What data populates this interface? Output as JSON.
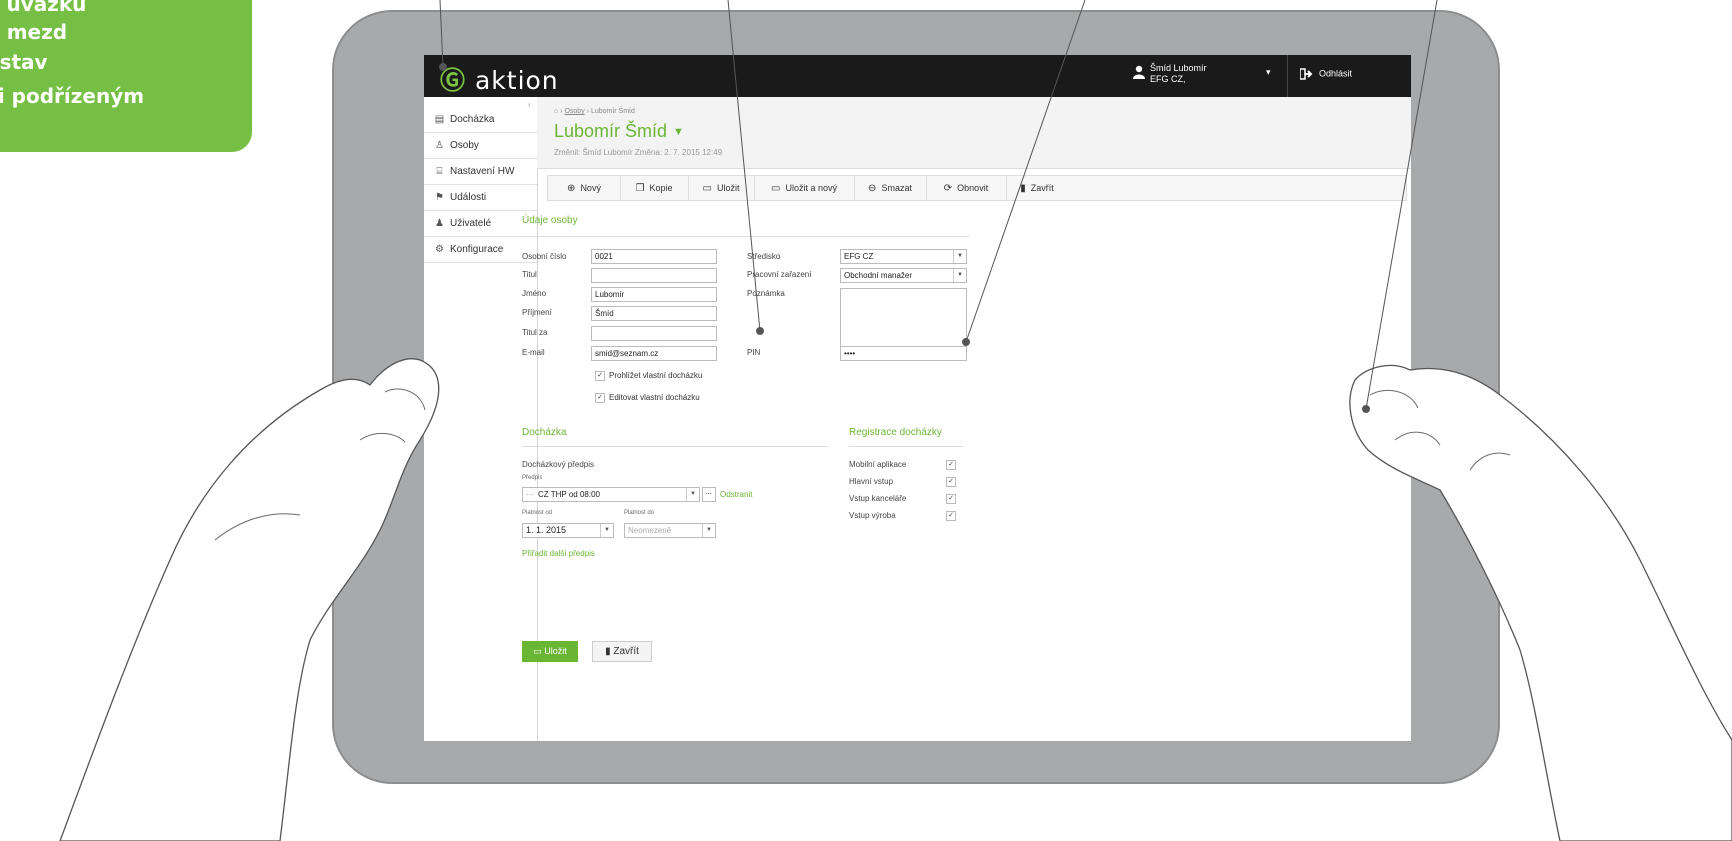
{
  "callout": {
    "lines": [
      "a úvazku",
      "o mezd",
      "estav",
      "či podřízeným"
    ],
    "color": "#74bf44"
  },
  "app": {
    "logo": "aktion",
    "accent": "#6bb535"
  },
  "topbar": {
    "user_name": "Šmíd Lubomír",
    "user_org": "EFG CZ,",
    "logout_label": "Odhlásit"
  },
  "sidebar": {
    "items": [
      {
        "label": "Docházka",
        "icon": "calendar-icon"
      },
      {
        "label": "Osoby",
        "icon": "person-icon"
      },
      {
        "label": "Nastavení HW",
        "icon": "hardware-icon"
      },
      {
        "label": "Události",
        "icon": "events-icon"
      },
      {
        "label": "Uživatelé",
        "icon": "users-icon"
      },
      {
        "label": "Konfigurace",
        "icon": "gear-icon"
      }
    ]
  },
  "header": {
    "breadcrumb_link": "Osoby",
    "breadcrumb_current": "Lubomír Šmíd",
    "title": "Lubomír Šmíd",
    "changed_info": "Změnil: Šmíd Lubomír Změna: 2. 7. 2015 12:49"
  },
  "toolbar": {
    "new": "Nový",
    "copy": "Kopie",
    "save": "Uložit",
    "save_new": "Uložit a nový",
    "delete": "Smazat",
    "refresh": "Obnovit",
    "close": "Zavřít"
  },
  "person": {
    "section_title": "Údaje osoby",
    "personal_number_label": "Osobní číslo",
    "personal_number": "0021",
    "title_label": "Titul",
    "title_value": "",
    "first_name_label": "Jméno",
    "first_name": "Lubomír",
    "last_name_label": "Příjmení",
    "last_name": "Šmíd",
    "title_after_label": "Titul za",
    "title_after": "",
    "email_label": "E-mail",
    "email": "smid@seznam.cz",
    "view_own_label": "Prohlížet vlastní docházku",
    "edit_own_label": "Editovat vlastní docházku",
    "center_label": "Středisko",
    "center": "EFG CZ",
    "position_label": "Pracovní zařazení",
    "position": "Obchodní manažer",
    "note_label": "Poznámka",
    "note": "",
    "pin_label": "PIN",
    "pin": "••••"
  },
  "attendance": {
    "section_title": "Docházka",
    "rule_title": "Docházkový předpis",
    "rule_small_label": "Předpis",
    "rule_value": "CZ THP od 08:00",
    "remove_link": "Odstranit",
    "valid_from_label": "Platnost od",
    "valid_from": "1. 1. 2015",
    "valid_to_label": "Platnost do",
    "valid_to": "Neomezeně",
    "add_rule_link": "Přiřadit další předpis"
  },
  "registration": {
    "section_title": "Registrace docházky",
    "items": [
      {
        "label": "Mobilní aplikace",
        "checked": "✓"
      },
      {
        "label": "Hlavní vstup",
        "checked": "✓"
      },
      {
        "label": "Vstup kanceláře",
        "checked": "✓"
      },
      {
        "label": "Vstup výroba",
        "checked": "✓"
      }
    ]
  },
  "form_buttons": {
    "save": "Uložit",
    "close": "Zavřít"
  }
}
